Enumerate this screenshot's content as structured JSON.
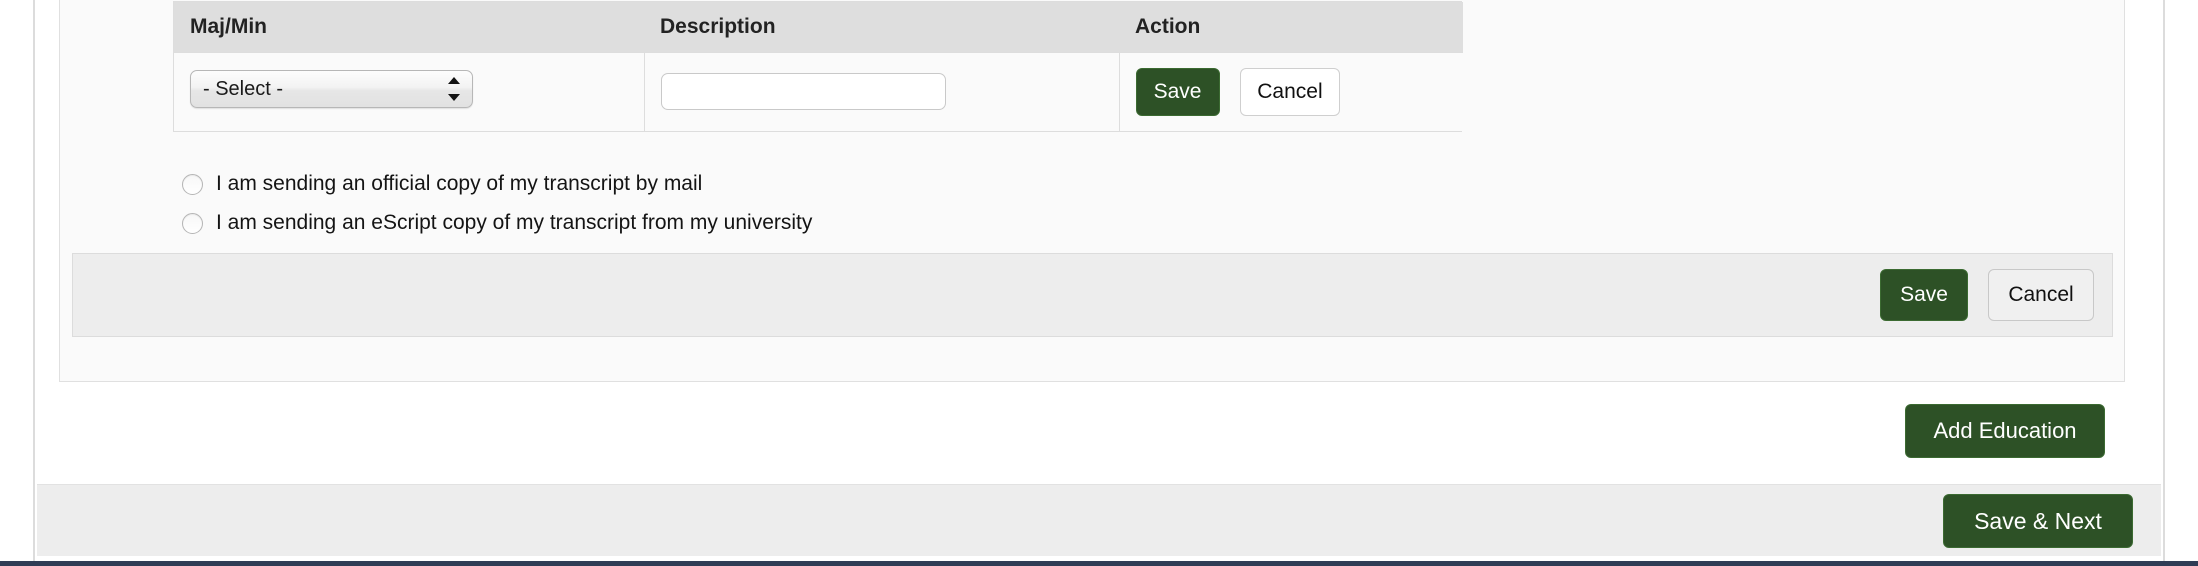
{
  "table": {
    "headers": [
      "Maj/Min",
      "Description",
      "Action"
    ],
    "row": {
      "select_value": "- Select -",
      "description_value": "",
      "description_placeholder": "",
      "save_label": "Save",
      "cancel_label": "Cancel"
    }
  },
  "transcript_options": [
    {
      "label": "I am sending an official copy of my transcript by mail",
      "selected": false
    },
    {
      "label": "I am sending an eScript copy of my transcript from my university",
      "selected": false
    }
  ],
  "panel_actions": {
    "save_label": "Save",
    "cancel_label": "Cancel"
  },
  "add_education": {
    "label": "Add Education"
  },
  "footer": {
    "save_next_label": "Save & Next"
  },
  "colors": {
    "primary_green": "#2d5126",
    "header_grey": "#dedede",
    "bar_grey": "#ededed",
    "panel_bg": "#fafafa",
    "bottom_strip": "#2f3c55"
  }
}
